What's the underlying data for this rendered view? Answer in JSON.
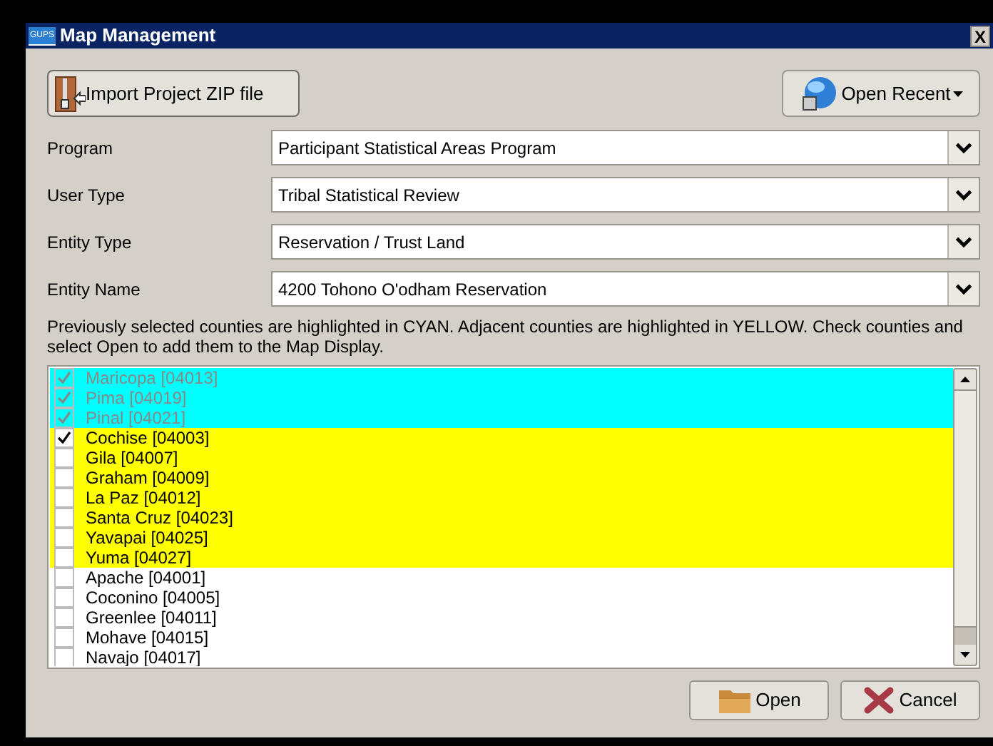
{
  "window": {
    "title": "Map Management",
    "icon_text": "GUPS",
    "close": "X"
  },
  "toolbar": {
    "import_button": "Import Project ZIP file",
    "recent_button": "Open Recent"
  },
  "fields": [
    {
      "label": "Program",
      "value": "Participant Statistical Areas Program"
    },
    {
      "label": "User Type",
      "value": "Tribal Statistical Review"
    },
    {
      "label": "Entity Type",
      "value": "Reservation / Trust Land"
    },
    {
      "label": "Entity Name",
      "value": "4200 Tohono O'odham Reservation"
    }
  ],
  "instructions": "Previously selected counties are highlighted in CYAN. Adjacent counties are highlighted in YELLOW. Check counties and select Open to add them to the Map Display.",
  "counties": [
    {
      "label": "Maricopa [04013]",
      "checked": true,
      "disabled": true,
      "color": "#00ffff"
    },
    {
      "label": "Pima [04019]",
      "checked": true,
      "disabled": true,
      "color": "#00ffff"
    },
    {
      "label": "Pinal [04021]",
      "checked": true,
      "disabled": true,
      "color": "#00ffff"
    },
    {
      "label": "Cochise [04003]",
      "checked": true,
      "disabled": false,
      "color": "#ffff00"
    },
    {
      "label": "Gila [04007]",
      "checked": false,
      "disabled": false,
      "color": "#ffff00"
    },
    {
      "label": "Graham [04009]",
      "checked": false,
      "disabled": false,
      "color": "#ffff00"
    },
    {
      "label": "La Paz [04012]",
      "checked": false,
      "disabled": false,
      "color": "#ffff00"
    },
    {
      "label": "Santa Cruz [04023]",
      "checked": false,
      "disabled": false,
      "color": "#ffff00"
    },
    {
      "label": "Yavapai [04025]",
      "checked": false,
      "disabled": false,
      "color": "#ffff00"
    },
    {
      "label": "Yuma [04027]",
      "checked": false,
      "disabled": false,
      "color": "#ffff00"
    },
    {
      "label": "Apache [04001]",
      "checked": false,
      "disabled": false,
      "color": "#ffffff"
    },
    {
      "label": "Coconino [04005]",
      "checked": false,
      "disabled": false,
      "color": "#ffffff"
    },
    {
      "label": "Greenlee [04011]",
      "checked": false,
      "disabled": false,
      "color": "#ffffff"
    },
    {
      "label": "Mohave [04015]",
      "checked": false,
      "disabled": false,
      "color": "#ffffff"
    },
    {
      "label": "Navajo [04017]",
      "checked": false,
      "disabled": false,
      "color": "#ffffff"
    }
  ],
  "buttons": [
    "Open",
    "Cancel"
  ]
}
